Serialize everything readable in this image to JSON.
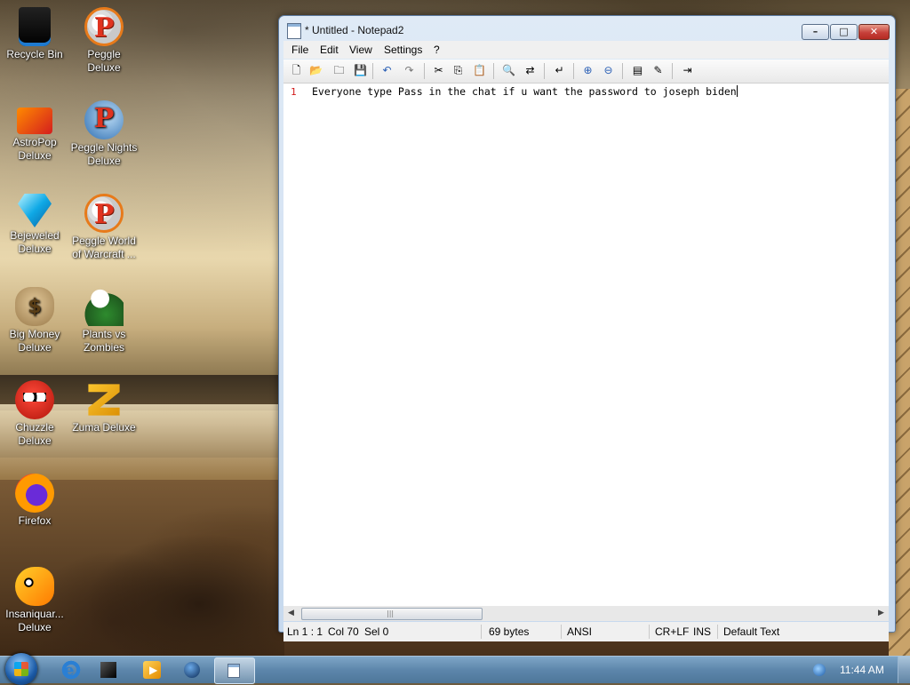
{
  "desktop": {
    "icons": [
      {
        "label": "Recycle Bin",
        "icon": "recycle-bin-icon"
      },
      {
        "label": "Peggle Deluxe",
        "icon": "peggle-icon"
      },
      {
        "label": "AstroPop Deluxe",
        "icon": "astropop-icon"
      },
      {
        "label": "Peggle Nights Deluxe",
        "icon": "peggle-nights-icon"
      },
      {
        "label": "Bejeweled Deluxe",
        "icon": "bejeweled-icon"
      },
      {
        "label": "Peggle World of Warcraft ...",
        "icon": "peggle-wow-icon"
      },
      {
        "label": "Big Money Deluxe",
        "icon": "big-money-icon"
      },
      {
        "label": "Plants vs Zombies",
        "icon": "plants-vs-zombies-icon"
      },
      {
        "label": "Chuzzle Deluxe",
        "icon": "chuzzle-icon"
      },
      {
        "label": "Zuma Deluxe",
        "icon": "zuma-icon"
      },
      {
        "label": "Firefox",
        "icon": "firefox-icon"
      },
      {
        "label": "Insaniquar... Deluxe",
        "icon": "insaniquarium-icon"
      }
    ]
  },
  "window": {
    "title": "* Untitled - Notepad2",
    "buttons": {
      "minimize": "–",
      "maximize": "□",
      "close": "✕"
    },
    "menu": [
      "File",
      "Edit",
      "View",
      "Settings",
      "?"
    ],
    "toolbar": [
      {
        "icon": "new-file-icon",
        "glyph": "🗋"
      },
      {
        "icon": "open-folder-icon",
        "glyph": "📂"
      },
      {
        "icon": "browse-icon",
        "glyph": "🗀"
      },
      {
        "icon": "save-icon",
        "glyph": "💾"
      },
      {
        "icon": "undo-icon",
        "glyph": "↶"
      },
      {
        "icon": "redo-icon",
        "glyph": "↷"
      },
      {
        "icon": "cut-icon",
        "glyph": "✂"
      },
      {
        "icon": "copy-icon",
        "glyph": "⎘"
      },
      {
        "icon": "paste-icon",
        "glyph": "📋"
      },
      {
        "icon": "find-icon",
        "glyph": "🔍"
      },
      {
        "icon": "replace-icon",
        "glyph": "⇄"
      },
      {
        "icon": "word-wrap-icon",
        "glyph": "↵"
      },
      {
        "icon": "zoom-in-icon",
        "glyph": "⊕"
      },
      {
        "icon": "zoom-out-icon",
        "glyph": "⊖"
      },
      {
        "icon": "scheme-icon",
        "glyph": "▤"
      },
      {
        "icon": "customize-scheme-icon",
        "glyph": "✎"
      },
      {
        "icon": "exit-icon",
        "glyph": "⇥"
      }
    ],
    "editor": {
      "line_number": "1",
      "text": "Everyone type Pass in the chat if u want the password to joseph biden"
    },
    "status": {
      "position": "Ln 1 : 1",
      "column": "Col 70",
      "selection": "Sel 0",
      "size": "69 bytes",
      "encoding": "ANSI",
      "line_endings": "CR+LF",
      "insert_mode": "INS",
      "scheme": "Default Text"
    }
  },
  "taskbar": {
    "clock": "11:44 AM",
    "apps": [
      "internet-explorer-icon",
      "cube-icon",
      "media-player-icon",
      "ball-icon",
      "notepad2-icon"
    ]
  }
}
